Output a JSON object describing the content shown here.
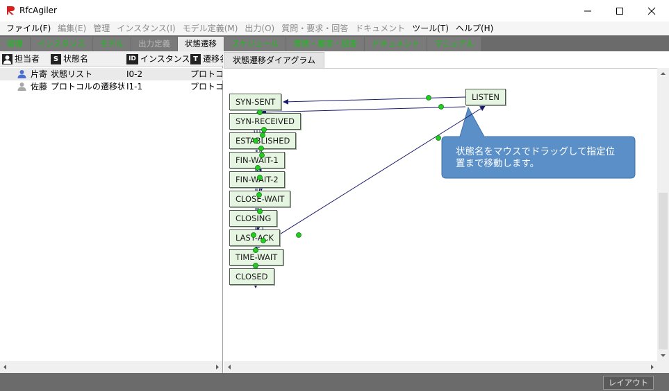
{
  "window": {
    "title": "RfcAgiler"
  },
  "menu": [
    {
      "label": "ファイル(F)",
      "enabled": true
    },
    {
      "label": "編集(E)",
      "enabled": false
    },
    {
      "label": "管理",
      "enabled": false
    },
    {
      "label": "インスタンス(I)",
      "enabled": false
    },
    {
      "label": "モデル定義(M)",
      "enabled": false
    },
    {
      "label": "出力(O)",
      "enabled": false
    },
    {
      "label": "質問・要求・回答",
      "enabled": false
    },
    {
      "label": "ドキュメント",
      "enabled": false
    },
    {
      "label": "ツール(T)",
      "enabled": true
    },
    {
      "label": "ヘルプ(H)",
      "enabled": true
    }
  ],
  "tabs": [
    {
      "label": "管理",
      "style": "green"
    },
    {
      "label": "インスタンス",
      "style": "green"
    },
    {
      "label": "モデル",
      "style": "green"
    },
    {
      "label": "出力定義",
      "style": "gray"
    },
    {
      "label": "状態遷移",
      "style": "active"
    },
    {
      "label": "スケジュール",
      "style": "green"
    },
    {
      "label": "質問・要求・回答",
      "style": "green"
    },
    {
      "label": "ドキュメント",
      "style": "green"
    },
    {
      "label": "マニュアル",
      "style": "green"
    }
  ],
  "list": {
    "headers": [
      {
        "label": "担当者",
        "icon": "person-icon"
      },
      {
        "label": "状態名",
        "icon": "S"
      },
      {
        "label": "インスタンスID",
        "icon": "ID"
      },
      {
        "label": "遷移名",
        "icon": "T"
      }
    ],
    "rows": [
      {
        "owner": "片寄",
        "state": "状態リスト",
        "id": "I0-2",
        "transition": "プロトコル",
        "owner_color": "#4a6fd0",
        "selected": true
      },
      {
        "owner": "佐藤",
        "state": "プロトコルの遷移状態",
        "id": "I1-1",
        "transition": "プロトコル",
        "owner_color": "#a8a8a8",
        "selected": false
      }
    ]
  },
  "diagram": {
    "tab_label": "状態遷移ダイアグラム",
    "states": [
      "SYN-SENT",
      "SYN-RECEIVED",
      "ESTABLISHED",
      "FIN-WAIT-1",
      "FIN-WAIT-2",
      "CLOSE-WAIT",
      "CLOSING",
      "LAST-ACK",
      "TIME-WAIT",
      "CLOSED"
    ],
    "listen_state": "LISTEN",
    "callout_text": "状態名をマウスでドラッグして指定位置まで移動します。",
    "node_fill": "#e6f5e1",
    "handle_color": "#22cc22",
    "callout_color": "#5a8fc8"
  },
  "status": {
    "layout_button": "レイアウト"
  }
}
